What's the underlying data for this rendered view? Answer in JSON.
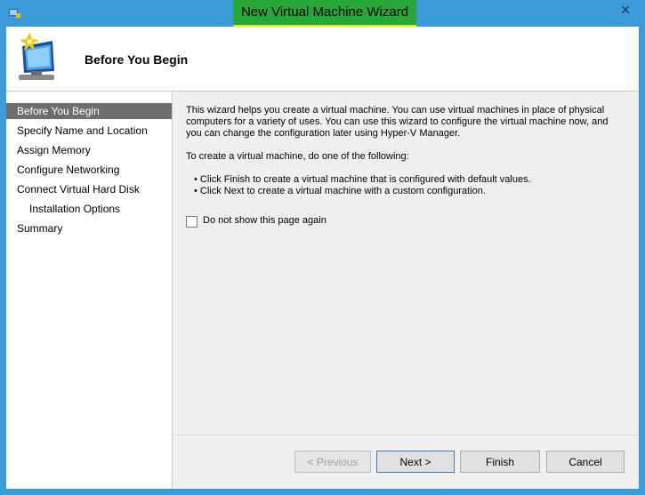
{
  "window": {
    "title": "New Virtual Machine Wizard",
    "close_glyph": "✕"
  },
  "header": {
    "title": "Before You Begin",
    "icon": "virtual-machine-icon"
  },
  "nav": {
    "items": [
      {
        "label": "Before You Begin"
      },
      {
        "label": "Specify Name and Location"
      },
      {
        "label": "Assign Memory"
      },
      {
        "label": "Configure Networking"
      },
      {
        "label": "Connect Virtual Hard Disk"
      },
      {
        "label": "Installation Options"
      },
      {
        "label": "Summary"
      }
    ]
  },
  "content": {
    "intro": "This wizard helps you create a virtual machine. You can use virtual machines in place of physical computers for a variety of uses. You can use this wizard to configure the virtual machine now, and you can change the configuration later using Hyper-V Manager.",
    "instruction": "To create a virtual machine, do one of the following:",
    "bullet1": "• Click Finish to create a virtual machine that is configured with default values.",
    "bullet2": "• Click Next to create a virtual machine with a custom configuration.",
    "checkbox_label": "Do not show this page again",
    "checkbox_checked": false
  },
  "buttons": {
    "previous": "< Previous",
    "next": "Next >",
    "finish": "Finish",
    "cancel": "Cancel"
  },
  "colors": {
    "titlebar": "#3c9bd9",
    "title_highlight_green": "#27a737",
    "title_highlight_yellow": "#dff000",
    "nav_selected": "#6e6e6e"
  }
}
